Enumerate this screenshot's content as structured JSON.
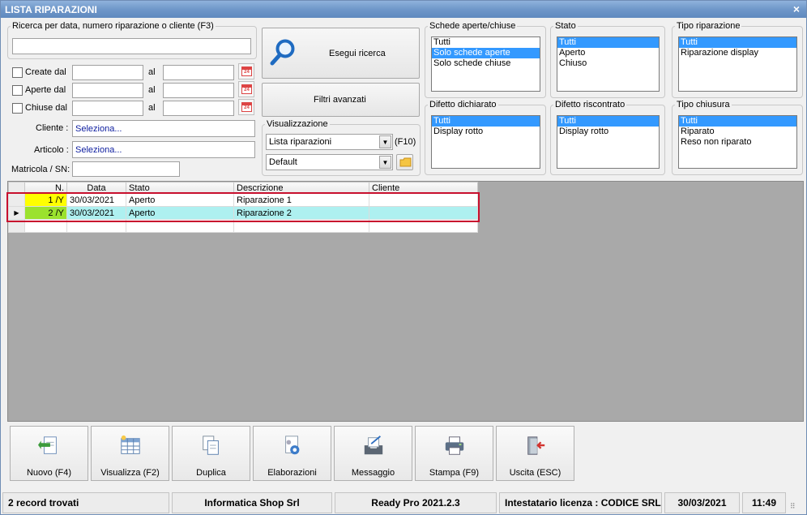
{
  "window": {
    "title": "LISTA RIPARAZIONI",
    "close_glyph": "×"
  },
  "search": {
    "group_label": "Ricerca per data, numero riparazione o cliente (F3)",
    "value": "",
    "button": "Esegui ricerca",
    "advanced_filters": "Filtri avanzati"
  },
  "date_filters": [
    {
      "label": "Create dal",
      "al": "al",
      "from": "",
      "to": "",
      "checked": false
    },
    {
      "label": "Aperte dal",
      "al": "al",
      "from": "",
      "to": "",
      "checked": false
    },
    {
      "label": "Chiuse dal",
      "al": "al",
      "from": "",
      "to": "",
      "checked": false
    }
  ],
  "calendar_icon_text": "24",
  "fields": {
    "cliente_label": "Cliente :",
    "cliente_value": "Seleziona...",
    "articolo_label": "Articolo :",
    "articolo_value": "Seleziona...",
    "matricola_label": "Matricola / SN:",
    "matricola_value": ""
  },
  "visualizzazione": {
    "label": "Visualizzazione",
    "view_value": "Lista riparazioni",
    "f10": "(F10)",
    "layout_value": "Default"
  },
  "filters": {
    "schede": {
      "label": "Schede aperte/chiuse",
      "items": [
        "Tutti",
        "Solo schede aperte",
        "Solo schede chiuse"
      ],
      "selected": 1
    },
    "stato": {
      "label": "Stato",
      "items": [
        "Tutti",
        "Aperto",
        "Chiuso"
      ],
      "selected": 0
    },
    "tipo_riparazione": {
      "label": "Tipo riparazione",
      "items": [
        "Tutti",
        "Riparazione display"
      ],
      "selected": 0
    },
    "difetto_dichiarato": {
      "label": "Difetto dichiarato",
      "items": [
        "Tutti",
        "Display rotto"
      ],
      "selected": 0
    },
    "difetto_riscontrato": {
      "label": "Difetto riscontrato",
      "items": [
        "Tutti",
        "Display rotto"
      ],
      "selected": 0
    },
    "tipo_chiusura": {
      "label": "Tipo chiusura",
      "items": [
        "Tutti",
        "Riparato",
        "Reso non riparato"
      ],
      "selected": 0
    }
  },
  "grid": {
    "columns": [
      "N.",
      "Data",
      "Stato",
      "Descrizione",
      "Cliente"
    ],
    "rows": [
      {
        "n": "1 /Y",
        "data": "30/03/2021",
        "stato": "Aperto",
        "descrizione": "Riparazione 1",
        "cliente": "",
        "n_color": "#ffff00",
        "row_color": "#ffffff",
        "current": false
      },
      {
        "n": "2 /Y",
        "data": "30/03/2021",
        "stato": "Aperto",
        "descrizione": "Riparazione 2",
        "cliente": "",
        "n_color": "#9be22e",
        "row_color": "#aef0f0",
        "current": true
      }
    ],
    "row_pointer": "▶"
  },
  "toolbar": [
    {
      "label": "Nuovo (F4)",
      "icon": "new-doc-icon"
    },
    {
      "label": "Visualizza (F2)",
      "icon": "view-grid-icon"
    },
    {
      "label": "Duplica",
      "icon": "duplicate-icon"
    },
    {
      "label": "Elaborazioni",
      "icon": "gear-doc-icon"
    },
    {
      "label": "Messaggio",
      "icon": "message-icon"
    },
    {
      "label": "Stampa (F9)",
      "icon": "printer-icon"
    },
    {
      "label": "Uscita (ESC)",
      "icon": "exit-door-icon"
    }
  ],
  "status": {
    "records": "2 record trovati",
    "company": "Informatica Shop Srl",
    "version": "Ready Pro 2021.2.3",
    "licensee": "Intestatario licenza : CODICE SRL",
    "date": "30/03/2021",
    "time": "11:49"
  },
  "colors": {
    "title_bar": "#6f97c9",
    "selection": "#3399ff",
    "highlight_border": "#c8102e"
  }
}
